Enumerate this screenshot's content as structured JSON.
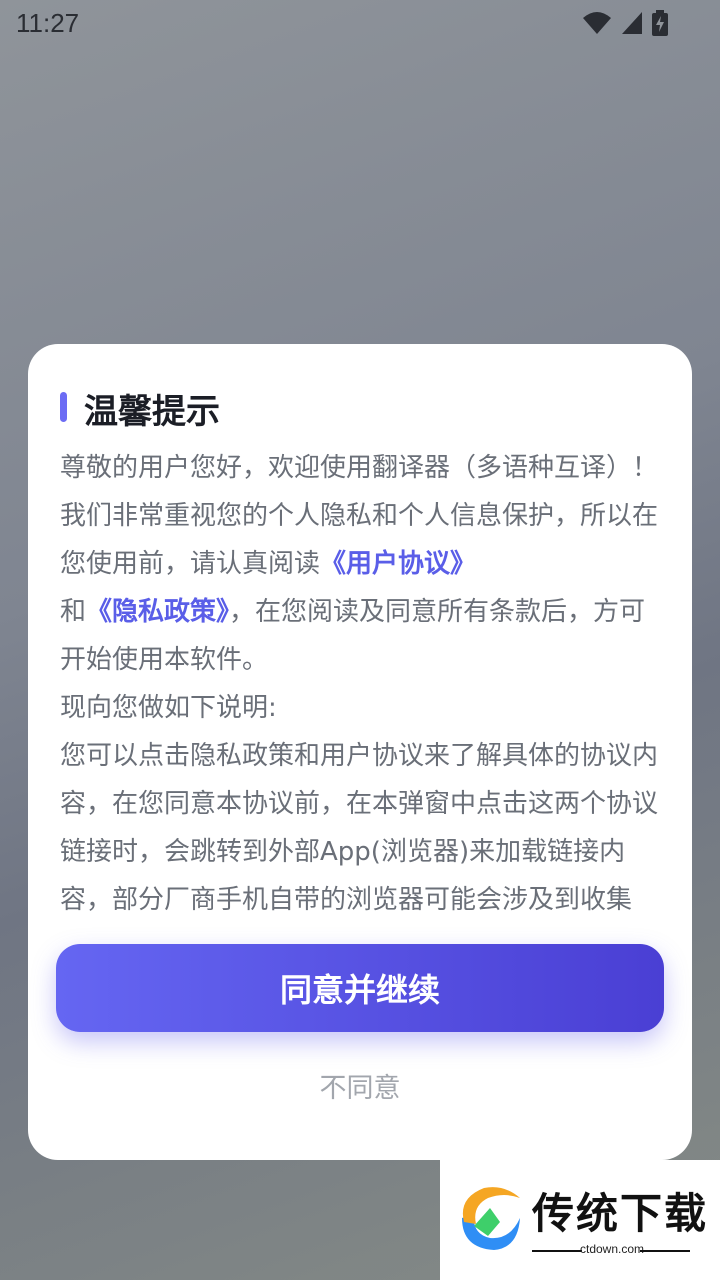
{
  "status_bar": {
    "time": "11:27",
    "icons": [
      "wifi-icon",
      "signal-icon",
      "battery-charging-icon"
    ]
  },
  "dialog": {
    "title": "温馨提示",
    "intro_before_link": "尊敬的用户您好，欢迎使用翻译器（多语种互译）！我们非常重视您的个人隐私和个人信息保护，所以在您使用前，请认真阅读",
    "user_agreement_link": "《用户协议》",
    "and_text": "和",
    "privacy_policy_link": "《隐私政策》",
    "intro_after_link": "，在您阅读及同意所有条款后，方可开始使用本软件。",
    "explanation_heading": "现向您做如下说明:",
    "explanation_body": "您可以点击隐私政策和用户协议来了解具体的协议内容，在您同意本协议前，在本弹窗中点击这两个协议链接时，会跳转到外部App(浏览器)来加载链接内容，部分厂商手机自带的浏览器可能会涉及到收集AndroidId,MAC,ip信息，BSSID，用",
    "agree_button": "同意并继续",
    "disagree_button": "不同意",
    "accent_color": "#5a5ee8"
  },
  "watermark": {
    "text": "传统下载",
    "domain": "ctdown.com"
  }
}
